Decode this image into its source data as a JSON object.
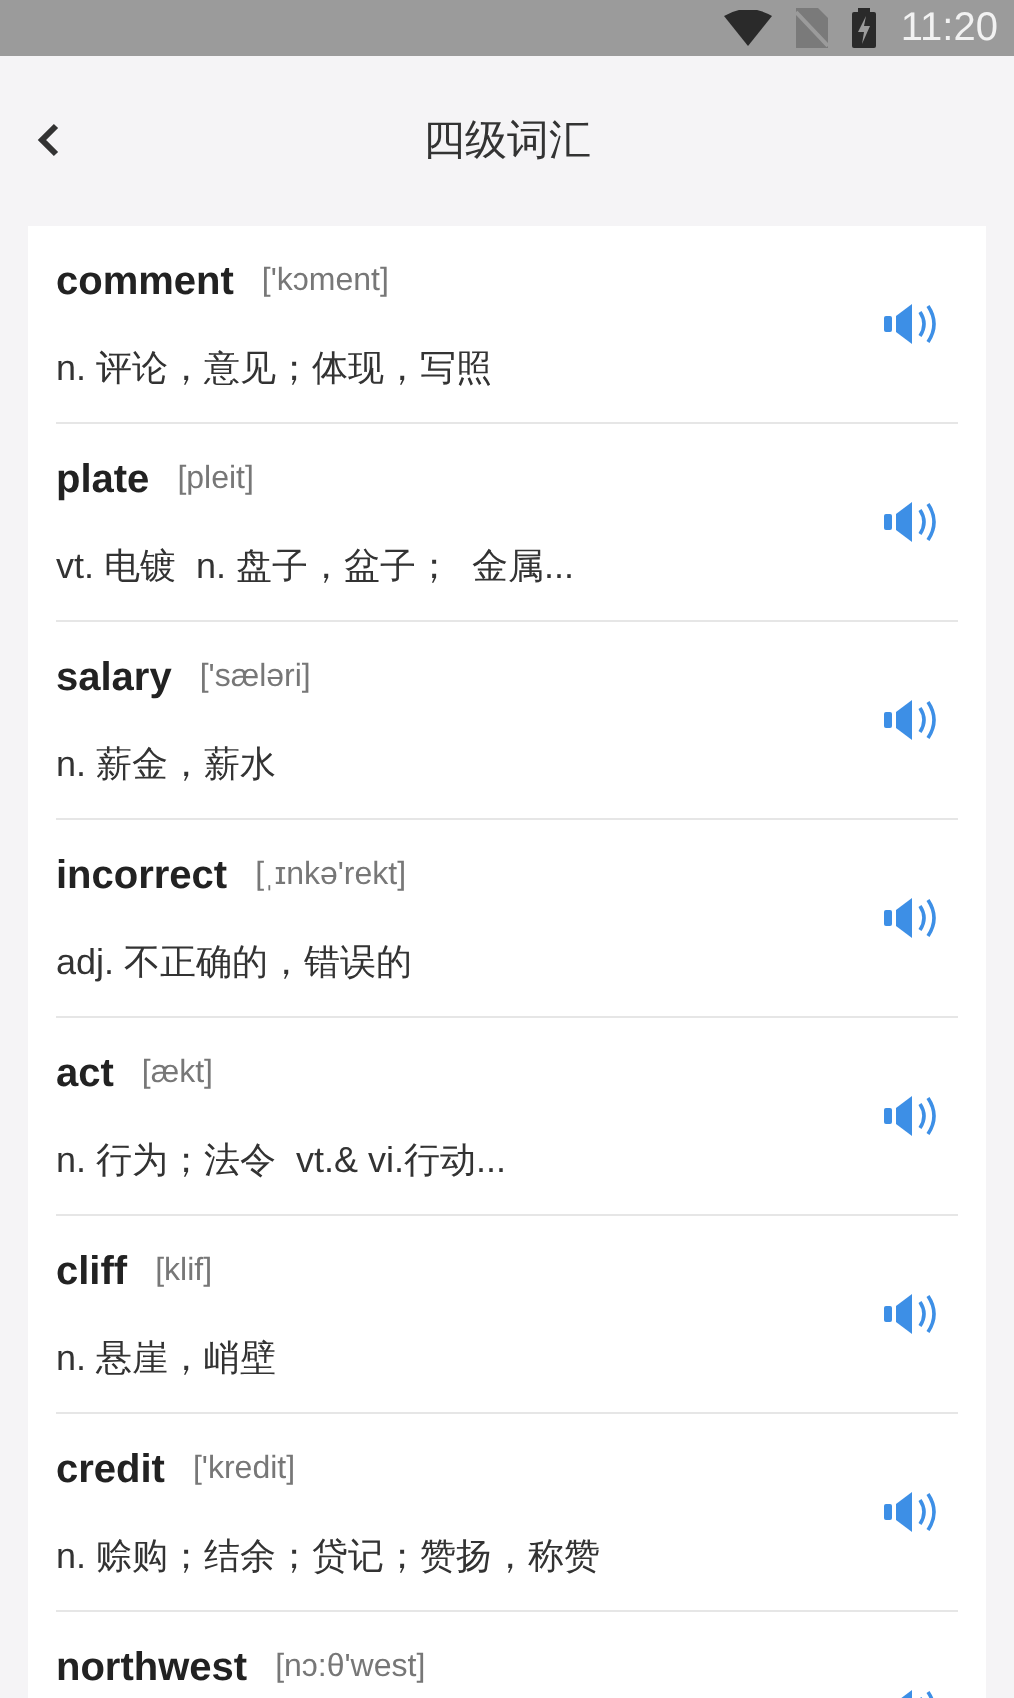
{
  "status_bar": {
    "time": "11:20"
  },
  "header": {
    "title": "四级词汇"
  },
  "words": [
    {
      "word": "comment",
      "phonetic": "['kɔment]",
      "definition": "n. 评论，意见；体现，写照"
    },
    {
      "word": "plate",
      "phonetic": "[pleit]",
      "definition": "vt. 电镀  n. 盘子，盆子；  金属..."
    },
    {
      "word": "salary",
      "phonetic": "['sæləri]",
      "definition": "n. 薪金，薪水"
    },
    {
      "word": "incorrect",
      "phonetic": "[ˌɪnkə'rekt]",
      "definition": "adj. 不正确的，错误的"
    },
    {
      "word": "act",
      "phonetic": "[ækt]",
      "definition": "n. 行为；法令  vt.& vi.行动..."
    },
    {
      "word": "cliff",
      "phonetic": "[klif]",
      "definition": "n. 悬崖，峭壁"
    },
    {
      "word": "credit",
      "phonetic": "['kredit]",
      "definition": "n. 赊购；结余；贷记；赞扬，称赞"
    },
    {
      "word": "northwest",
      "phonetic": "[nɔ:θ'west]"
    }
  ]
}
